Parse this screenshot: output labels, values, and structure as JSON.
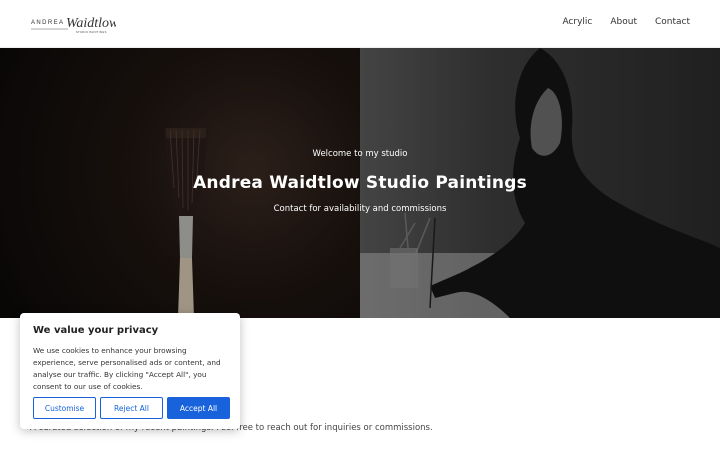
{
  "brand": {
    "logo_name": "ANDREA",
    "logo_script": "Waidtlow",
    "logo_tagline": "STUDIO PAINTINGS"
  },
  "nav": {
    "items": [
      "Acrylic",
      "About",
      "Contact"
    ]
  },
  "hero": {
    "welcome": "Welcome to my studio",
    "title": "Andrea Waidtlow Studio Paintings",
    "subtitle": "Contact for availability and commissions"
  },
  "intro": {
    "text": "A curated selection of my recent paintings. Feel free to reach out for inquiries or commissions."
  },
  "cookie": {
    "title": "We value your privacy",
    "body": "We use cookies to enhance your browsing experience, serve personalised ads or content, and analyse our traffic. By clicking \"Accept All\", you consent to our use of cookies.",
    "customise_label": "Customise",
    "reject_label": "Reject All",
    "accept_label": "Accept All"
  },
  "colors": {
    "accent": "#1863dc"
  }
}
